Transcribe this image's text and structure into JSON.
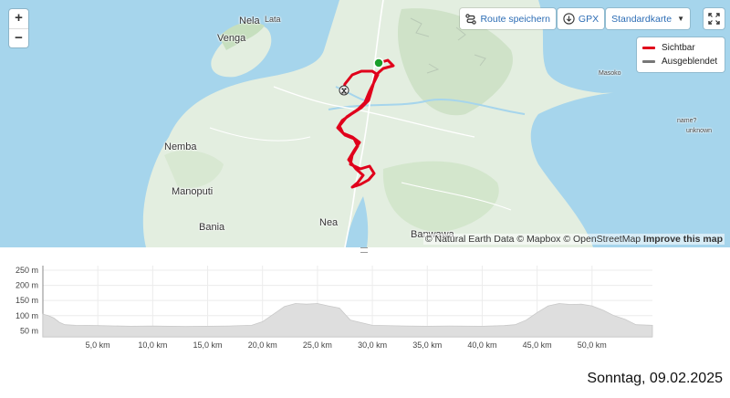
{
  "map": {
    "places": [
      {
        "name": "Nela"
      },
      {
        "name": "Lata"
      },
      {
        "name": "Venga"
      },
      {
        "name": "Nemba"
      },
      {
        "name": "Manoputi"
      },
      {
        "name": "Bania"
      },
      {
        "name": "Nea"
      },
      {
        "name": "Banwawa"
      },
      {
        "name": "Masoko"
      },
      {
        "name": "name?"
      },
      {
        "name": "unknown"
      }
    ],
    "zoom_in": "+",
    "zoom_out": "−",
    "route_color": "#e0001b",
    "start_marker_color": "#1a9e2a",
    "water_color": "#a6d5ec",
    "land_color": "#e3eee0"
  },
  "toolbar": {
    "save_route": "Route speichern",
    "gpx": "GPX",
    "map_type": "Standardkarte"
  },
  "legend": {
    "visible": "Sichtbar",
    "hidden": "Ausgeblendet",
    "visible_color": "#e0001b",
    "hidden_color": "#777777"
  },
  "attribution": {
    "natural_earth": "© Natural Earth Data",
    "mapbox": "© Mapbox",
    "osm": "© OpenStreetMap",
    "improve": "Improve this map"
  },
  "profile": {
    "y_ticks": [
      "250 m",
      "200 m",
      "150 m",
      "100 m",
      "50 m"
    ],
    "y_tick_values": [
      250,
      200,
      150,
      100,
      50
    ],
    "x_ticks": [
      "5,0 km",
      "10,0 km",
      "15,0 km",
      "20,0 km",
      "25,0 km",
      "30,0 km",
      "35,0 km",
      "40,0 km",
      "45,0 km",
      "50,0 km"
    ],
    "x_tick_values": [
      5,
      10,
      15,
      20,
      25,
      30,
      35,
      40,
      45,
      50
    ],
    "elevation_km": [
      0,
      0.5,
      1,
      1.5,
      2,
      3,
      5,
      8,
      10,
      13,
      15,
      17,
      19,
      20,
      21,
      22,
      23,
      24,
      25,
      26,
      27,
      27.5,
      28,
      30,
      33,
      35,
      37,
      40,
      42,
      43,
      44,
      45,
      46,
      47,
      48,
      49,
      50,
      51,
      52,
      53,
      54,
      55.5
    ],
    "elevation_m": [
      105,
      100,
      92,
      78,
      70,
      68,
      67,
      65,
      66,
      64,
      65,
      66,
      68,
      80,
      105,
      130,
      140,
      138,
      140,
      132,
      125,
      105,
      85,
      68,
      66,
      65,
      66,
      65,
      67,
      70,
      85,
      110,
      132,
      140,
      137,
      138,
      132,
      118,
      100,
      88,
      70,
      68
    ],
    "x_max": 55.5,
    "y_min": 30,
    "y_max": 265
  },
  "footer": {
    "date": "Sonntag, 09.02.2025"
  }
}
